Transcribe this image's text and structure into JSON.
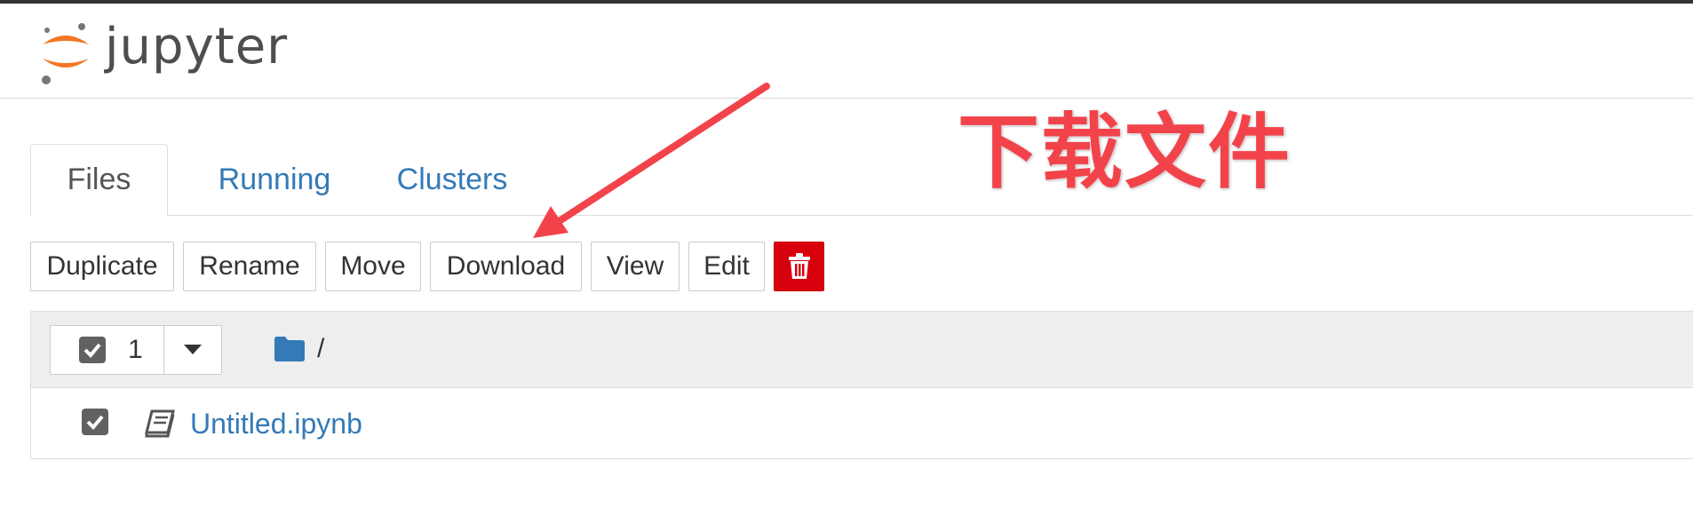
{
  "brand": {
    "name": "jupyter",
    "accent": "#f37726",
    "logo_dot_color": "#767677"
  },
  "tabs": [
    {
      "label": "Files",
      "active": true
    },
    {
      "label": "Running",
      "active": false
    },
    {
      "label": "Clusters",
      "active": false
    }
  ],
  "toolbar": {
    "duplicate_label": "Duplicate",
    "rename_label": "Rename",
    "move_label": "Move",
    "download_label": "Download",
    "view_label": "View",
    "edit_label": "Edit",
    "delete_icon": "trash-icon",
    "delete_color": "#d9000d"
  },
  "file_list": {
    "selected_count": "1",
    "path": "/",
    "folder_icon": "folder-icon",
    "rows": [
      {
        "name": "Untitled.ipynb",
        "icon": "notebook-icon",
        "checked": true
      }
    ]
  },
  "annotation": {
    "text": "下载文件",
    "color": "#f2434b"
  },
  "colors": {
    "link": "#337ab7",
    "header_bg": "#eeeeee",
    "checkbox": "#616161"
  }
}
